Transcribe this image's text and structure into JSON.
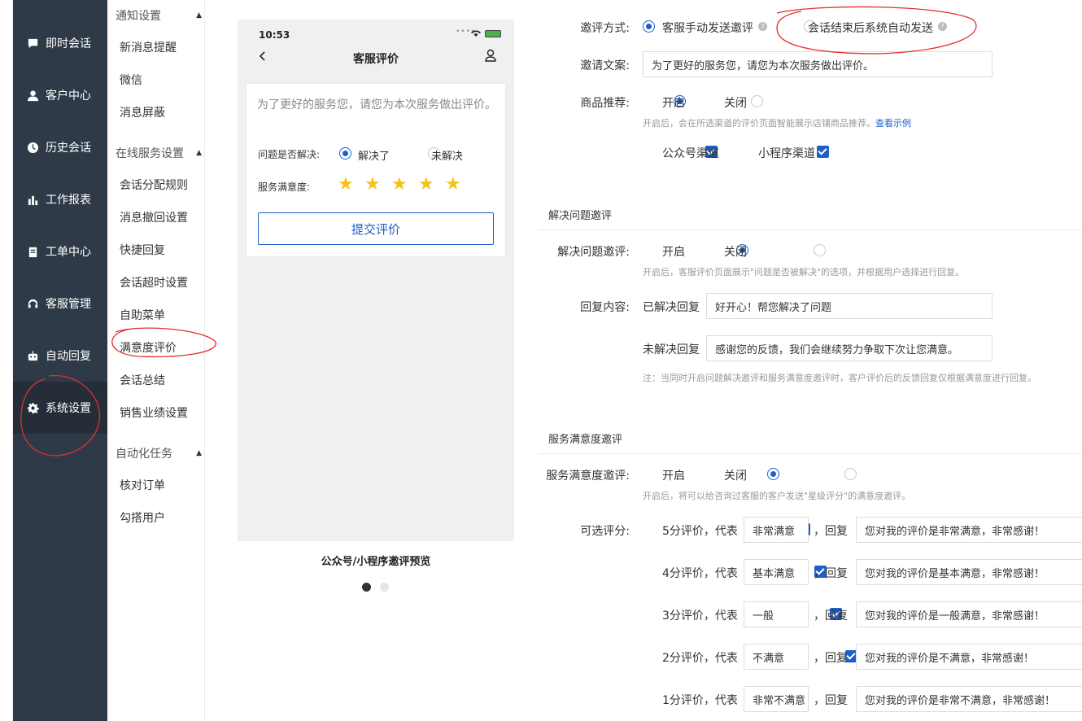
{
  "sidebar": {
    "items": [
      {
        "label": "即时会话",
        "icon": "chat-icon"
      },
      {
        "label": "客户中心",
        "icon": "user-icon"
      },
      {
        "label": "历史会话",
        "icon": "clock-icon"
      },
      {
        "label": "工作报表",
        "icon": "bar-chart-icon"
      },
      {
        "label": "工单中心",
        "icon": "clipboard-icon"
      },
      {
        "label": "客服管理",
        "icon": "headset-icon"
      },
      {
        "label": "自动回复",
        "icon": "robot-icon"
      },
      {
        "label": "系统设置",
        "icon": "gear-icon"
      }
    ],
    "active": "系统设置"
  },
  "subnav": {
    "groups": [
      {
        "title": "通知设置",
        "items": [
          "新消息提醒",
          "微信",
          "消息屏蔽"
        ]
      },
      {
        "title": "在线服务设置",
        "items": [
          "会话分配规则",
          "消息撤回设置",
          "快捷回复",
          "会话超时设置",
          "自助菜单",
          "满意度评价",
          "会话总结",
          "销售业绩设置"
        ]
      },
      {
        "title": "自动化任务",
        "items": [
          "核对订单",
          "勾搭用户"
        ]
      }
    ],
    "active": "满意度评价"
  },
  "preview": {
    "time": "10:53",
    "title": "客服评价",
    "invite_text": "为了更好的服务您，请您为本次服务做出评价。",
    "q_resolved": "问题是否解决:",
    "opt_resolved": "解决了",
    "opt_unresolved": "未解决",
    "q_satisfaction": "服务满意度:",
    "stars": 5,
    "submit": "提交评价",
    "caption": "公众号/小程序邀评预览",
    "page_current": 1,
    "page_total": 2
  },
  "form": {
    "invite_method_label": "邀评方式:",
    "invite_method_opt1": "客服手动发送邀评",
    "invite_method_opt2": "会话结束后系统自动发送",
    "invite_text_label": "邀请文案:",
    "invite_text_value": "为了更好的服务您，请您为本次服务做出评价。",
    "product_rec_label": "商品推荐:",
    "on": "开启",
    "off": "关闭",
    "product_rec_hint": "开启后，会在所选渠道的评价页面智能展示店铺商品推荐。",
    "product_rec_link": "查看示例",
    "channel1": "公众号渠道",
    "channel2": "小程序渠道",
    "section_resolve": "解决问题邀评",
    "resolve_label": "解决问题邀评:",
    "resolve_hint": "开启后，客服评价页面展示\"问题是否被解决\"的选项，并根据用户选择进行回复。",
    "reply_label": "回复内容:",
    "reply_resolved_label": "已解决回复",
    "reply_resolved_value": "好开心！帮您解决了问题",
    "reply_unresolved_label": "未解决回复",
    "reply_unresolved_value": "感谢您的反馈，我们会继续努力争取下次让您满意。",
    "reply_note": "注：当同时开启问题解决邀评和服务满意度邀评时，客户评价后的反馈回复仅根据满意度进行回复。",
    "section_satisfaction": "服务满意度邀评",
    "satisfaction_label": "服务满意度邀评:",
    "satisfaction_hint": "开启后，将可以给咨询过客服的客户发送\"星级评分\"的满意度邀评。",
    "scores_label": "可选评分:",
    "rep": "，回复",
    "scores": [
      {
        "prefix": "5分评价，代表",
        "name": "非常满意",
        "reply": "您对我的评价是非常满意，非常感谢！"
      },
      {
        "prefix": "4分评价，代表",
        "name": "基本满意",
        "reply": "您对我的评价是基本满意，非常感谢！"
      },
      {
        "prefix": "3分评价，代表",
        "name": "一般",
        "reply": "您对我的评价是一般满意，非常感谢！"
      },
      {
        "prefix": "2分评价，代表",
        "name": "不满意",
        "reply": "您对我的评价是不满意，非常感谢！"
      },
      {
        "prefix": "1分评价，代表",
        "name": "非常不满意",
        "reply": "您对我的评价是非常不满意，非常感谢！"
      }
    ]
  },
  "colors": {
    "nav_bg": "#2f3a48",
    "accent": "#1d5fc9",
    "star": "#f7c21a",
    "annotation": "#e0312f"
  }
}
